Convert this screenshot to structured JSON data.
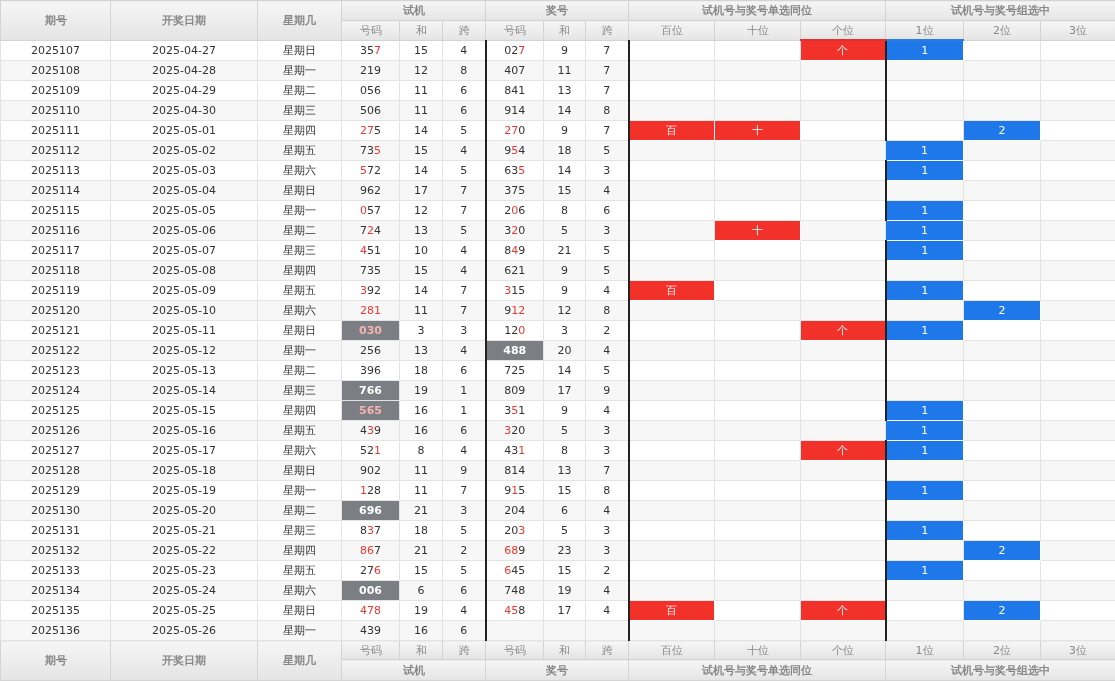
{
  "header": {
    "columns": [
      "期号",
      "开奖日期",
      "星期几"
    ],
    "groups": [
      {
        "title": "试机",
        "subs": [
          "号码",
          "和",
          "跨"
        ]
      },
      {
        "title": "奖号",
        "subs": [
          "号码",
          "和",
          "跨"
        ]
      },
      {
        "title": "试机号与奖号单选同位",
        "subs": [
          "百位",
          "十位",
          "个位"
        ]
      },
      {
        "title": "试机号与奖号组选中",
        "subs": [
          "1位",
          "2位",
          "3位"
        ]
      }
    ]
  },
  "rows": [
    {
      "issue": "2025107",
      "date": "2025-04-27",
      "weekday": "星期日",
      "test": {
        "num": "357",
        "red": [
          false,
          false,
          true
        ],
        "highlight": false,
        "sum": "15",
        "span": "4"
      },
      "draw": {
        "num": "027",
        "red": [
          false,
          false,
          true
        ],
        "highlight": false,
        "sum": "9",
        "span": "7"
      },
      "single": {
        "units": "个"
      },
      "group": {
        "first": "1"
      }
    },
    {
      "issue": "2025108",
      "date": "2025-04-28",
      "weekday": "星期一",
      "test": {
        "num": "219",
        "red": [
          false,
          false,
          false
        ],
        "highlight": false,
        "sum": "12",
        "span": "8"
      },
      "draw": {
        "num": "407",
        "red": [
          false,
          false,
          false
        ],
        "highlight": false,
        "sum": "11",
        "span": "7"
      }
    },
    {
      "issue": "2025109",
      "date": "2025-04-29",
      "weekday": "星期二",
      "test": {
        "num": "056",
        "red": [
          false,
          false,
          false
        ],
        "highlight": false,
        "sum": "11",
        "span": "6"
      },
      "draw": {
        "num": "841",
        "red": [
          false,
          false,
          false
        ],
        "highlight": false,
        "sum": "13",
        "span": "7"
      }
    },
    {
      "issue": "2025110",
      "date": "2025-04-30",
      "weekday": "星期三",
      "test": {
        "num": "506",
        "red": [
          false,
          false,
          false
        ],
        "highlight": false,
        "sum": "11",
        "span": "6"
      },
      "draw": {
        "num": "914",
        "red": [
          false,
          false,
          false
        ],
        "highlight": false,
        "sum": "14",
        "span": "8"
      }
    },
    {
      "issue": "2025111",
      "date": "2025-05-01",
      "weekday": "星期四",
      "test": {
        "num": "275",
        "red": [
          true,
          true,
          false
        ],
        "highlight": false,
        "sum": "14",
        "span": "5"
      },
      "draw": {
        "num": "270",
        "red": [
          true,
          true,
          false
        ],
        "highlight": false,
        "sum": "9",
        "span": "7"
      },
      "single": {
        "hundreds": "百",
        "tens": "十"
      },
      "group": {
        "second": "2"
      }
    },
    {
      "issue": "2025112",
      "date": "2025-05-02",
      "weekday": "星期五",
      "test": {
        "num": "735",
        "red": [
          false,
          false,
          true
        ],
        "highlight": false,
        "sum": "15",
        "span": "4"
      },
      "draw": {
        "num": "954",
        "red": [
          false,
          true,
          false
        ],
        "highlight": false,
        "sum": "18",
        "span": "5"
      },
      "group": {
        "first": "1"
      }
    },
    {
      "issue": "2025113",
      "date": "2025-05-03",
      "weekday": "星期六",
      "test": {
        "num": "572",
        "red": [
          true,
          false,
          false
        ],
        "highlight": false,
        "sum": "14",
        "span": "5"
      },
      "draw": {
        "num": "635",
        "red": [
          false,
          false,
          true
        ],
        "highlight": false,
        "sum": "14",
        "span": "3"
      },
      "group": {
        "first": "1"
      }
    },
    {
      "issue": "2025114",
      "date": "2025-05-04",
      "weekday": "星期日",
      "test": {
        "num": "962",
        "red": [
          false,
          false,
          false
        ],
        "highlight": false,
        "sum": "17",
        "span": "7"
      },
      "draw": {
        "num": "375",
        "red": [
          false,
          false,
          false
        ],
        "highlight": false,
        "sum": "15",
        "span": "4"
      }
    },
    {
      "issue": "2025115",
      "date": "2025-05-05",
      "weekday": "星期一",
      "test": {
        "num": "057",
        "red": [
          true,
          false,
          false
        ],
        "highlight": false,
        "sum": "12",
        "span": "7"
      },
      "draw": {
        "num": "206",
        "red": [
          false,
          true,
          false
        ],
        "highlight": false,
        "sum": "8",
        "span": "6"
      },
      "group": {
        "first": "1"
      }
    },
    {
      "issue": "2025116",
      "date": "2025-05-06",
      "weekday": "星期二",
      "test": {
        "num": "724",
        "red": [
          false,
          true,
          false
        ],
        "highlight": false,
        "sum": "13",
        "span": "5"
      },
      "draw": {
        "num": "320",
        "red": [
          false,
          true,
          false
        ],
        "highlight": false,
        "sum": "5",
        "span": "3"
      },
      "single": {
        "tens": "十"
      },
      "group": {
        "first": "1"
      }
    },
    {
      "issue": "2025117",
      "date": "2025-05-07",
      "weekday": "星期三",
      "test": {
        "num": "451",
        "red": [
          true,
          false,
          false
        ],
        "highlight": false,
        "sum": "10",
        "span": "4"
      },
      "draw": {
        "num": "849",
        "red": [
          false,
          true,
          false
        ],
        "highlight": false,
        "sum": "21",
        "span": "5"
      },
      "group": {
        "first": "1"
      }
    },
    {
      "issue": "2025118",
      "date": "2025-05-08",
      "weekday": "星期四",
      "test": {
        "num": "735",
        "red": [
          false,
          false,
          false
        ],
        "highlight": false,
        "sum": "15",
        "span": "4"
      },
      "draw": {
        "num": "621",
        "red": [
          false,
          false,
          false
        ],
        "highlight": false,
        "sum": "9",
        "span": "5"
      }
    },
    {
      "issue": "2025119",
      "date": "2025-05-09",
      "weekday": "星期五",
      "test": {
        "num": "392",
        "red": [
          true,
          false,
          false
        ],
        "highlight": false,
        "sum": "14",
        "span": "7"
      },
      "draw": {
        "num": "315",
        "red": [
          true,
          false,
          false
        ],
        "highlight": false,
        "sum": "9",
        "span": "4"
      },
      "single": {
        "hundreds": "百"
      },
      "group": {
        "first": "1"
      }
    },
    {
      "issue": "2025120",
      "date": "2025-05-10",
      "weekday": "星期六",
      "test": {
        "num": "281",
        "red": [
          true,
          true,
          true
        ],
        "highlight": false,
        "sum": "11",
        "span": "7"
      },
      "draw": {
        "num": "912",
        "red": [
          false,
          true,
          true
        ],
        "highlight": false,
        "sum": "12",
        "span": "8"
      },
      "group": {
        "second": "2"
      }
    },
    {
      "issue": "2025121",
      "date": "2025-05-11",
      "weekday": "星期日",
      "test": {
        "num": "030",
        "red": [
          true,
          true,
          true
        ],
        "highlight": true,
        "sum": "3",
        "span": "3"
      },
      "draw": {
        "num": "120",
        "red": [
          false,
          false,
          true
        ],
        "highlight": false,
        "sum": "3",
        "span": "2"
      },
      "single": {
        "units": "个"
      },
      "group": {
        "first": "1"
      }
    },
    {
      "issue": "2025122",
      "date": "2025-05-12",
      "weekday": "星期一",
      "test": {
        "num": "256",
        "red": [
          false,
          false,
          false
        ],
        "highlight": false,
        "sum": "13",
        "span": "4"
      },
      "draw": {
        "num": "488",
        "red": [
          false,
          false,
          false
        ],
        "highlight": true,
        "sum": "20",
        "span": "4"
      }
    },
    {
      "issue": "2025123",
      "date": "2025-05-13",
      "weekday": "星期二",
      "test": {
        "num": "396",
        "red": [
          false,
          false,
          false
        ],
        "highlight": false,
        "sum": "18",
        "span": "6"
      },
      "draw": {
        "num": "725",
        "red": [
          false,
          false,
          false
        ],
        "highlight": false,
        "sum": "14",
        "span": "5"
      }
    },
    {
      "issue": "2025124",
      "date": "2025-05-14",
      "weekday": "星期三",
      "test": {
        "num": "766",
        "red": [
          false,
          false,
          false
        ],
        "highlight": true,
        "sum": "19",
        "span": "1"
      },
      "draw": {
        "num": "809",
        "red": [
          false,
          false,
          false
        ],
        "highlight": false,
        "sum": "17",
        "span": "9"
      }
    },
    {
      "issue": "2025125",
      "date": "2025-05-15",
      "weekday": "星期四",
      "test": {
        "num": "565",
        "red": [
          true,
          true,
          true
        ],
        "highlight": true,
        "sum": "16",
        "span": "1"
      },
      "draw": {
        "num": "351",
        "red": [
          false,
          true,
          false
        ],
        "highlight": false,
        "sum": "9",
        "span": "4"
      },
      "group": {
        "first": "1"
      }
    },
    {
      "issue": "2025126",
      "date": "2025-05-16",
      "weekday": "星期五",
      "test": {
        "num": "439",
        "red": [
          false,
          true,
          false
        ],
        "highlight": false,
        "sum": "16",
        "span": "6"
      },
      "draw": {
        "num": "320",
        "red": [
          true,
          false,
          false
        ],
        "highlight": false,
        "sum": "5",
        "span": "3"
      },
      "group": {
        "first": "1"
      }
    },
    {
      "issue": "2025127",
      "date": "2025-05-17",
      "weekday": "星期六",
      "test": {
        "num": "521",
        "red": [
          false,
          false,
          true
        ],
        "highlight": false,
        "sum": "8",
        "span": "4"
      },
      "draw": {
        "num": "431",
        "red": [
          false,
          false,
          true
        ],
        "highlight": false,
        "sum": "8",
        "span": "3"
      },
      "single": {
        "units": "个"
      },
      "group": {
        "first": "1"
      }
    },
    {
      "issue": "2025128",
      "date": "2025-05-18",
      "weekday": "星期日",
      "test": {
        "num": "902",
        "red": [
          false,
          false,
          false
        ],
        "highlight": false,
        "sum": "11",
        "span": "9"
      },
      "draw": {
        "num": "814",
        "red": [
          false,
          false,
          false
        ],
        "highlight": false,
        "sum": "13",
        "span": "7"
      }
    },
    {
      "issue": "2025129",
      "date": "2025-05-19",
      "weekday": "星期一",
      "test": {
        "num": "128",
        "red": [
          true,
          false,
          false
        ],
        "highlight": false,
        "sum": "11",
        "span": "7"
      },
      "draw": {
        "num": "915",
        "red": [
          false,
          true,
          false
        ],
        "highlight": false,
        "sum": "15",
        "span": "8"
      },
      "group": {
        "first": "1"
      }
    },
    {
      "issue": "2025130",
      "date": "2025-05-20",
      "weekday": "星期二",
      "test": {
        "num": "696",
        "red": [
          false,
          false,
          false
        ],
        "highlight": true,
        "sum": "21",
        "span": "3"
      },
      "draw": {
        "num": "204",
        "red": [
          false,
          false,
          false
        ],
        "highlight": false,
        "sum": "6",
        "span": "4"
      }
    },
    {
      "issue": "2025131",
      "date": "2025-05-21",
      "weekday": "星期三",
      "test": {
        "num": "837",
        "red": [
          false,
          true,
          false
        ],
        "highlight": false,
        "sum": "18",
        "span": "5"
      },
      "draw": {
        "num": "203",
        "red": [
          false,
          false,
          true
        ],
        "highlight": false,
        "sum": "5",
        "span": "3"
      },
      "group": {
        "first": "1"
      }
    },
    {
      "issue": "2025132",
      "date": "2025-05-22",
      "weekday": "星期四",
      "test": {
        "num": "867",
        "red": [
          true,
          true,
          false
        ],
        "highlight": false,
        "sum": "21",
        "span": "2"
      },
      "draw": {
        "num": "689",
        "red": [
          true,
          true,
          false
        ],
        "highlight": false,
        "sum": "23",
        "span": "3"
      },
      "group": {
        "second": "2"
      }
    },
    {
      "issue": "2025133",
      "date": "2025-05-23",
      "weekday": "星期五",
      "test": {
        "num": "276",
        "red": [
          false,
          false,
          true
        ],
        "highlight": false,
        "sum": "15",
        "span": "5"
      },
      "draw": {
        "num": "645",
        "red": [
          true,
          false,
          false
        ],
        "highlight": false,
        "sum": "15",
        "span": "2"
      },
      "group": {
        "first": "1"
      }
    },
    {
      "issue": "2025134",
      "date": "2025-05-24",
      "weekday": "星期六",
      "test": {
        "num": "006",
        "red": [
          false,
          false,
          false
        ],
        "highlight": true,
        "sum": "6",
        "span": "6"
      },
      "draw": {
        "num": "748",
        "red": [
          false,
          false,
          false
        ],
        "highlight": false,
        "sum": "19",
        "span": "4"
      }
    },
    {
      "issue": "2025135",
      "date": "2025-05-25",
      "weekday": "星期日",
      "test": {
        "num": "478",
        "red": [
          true,
          true,
          true
        ],
        "highlight": false,
        "sum": "19",
        "span": "4"
      },
      "draw": {
        "num": "458",
        "red": [
          true,
          true,
          false
        ],
        "highlight": false,
        "sum": "17",
        "span": "4"
      },
      "single": {
        "hundreds": "百",
        "units": "个"
      },
      "group": {
        "second": "2"
      }
    },
    {
      "issue": "2025136",
      "date": "2025-05-26",
      "weekday": "星期一",
      "test": {
        "num": "439",
        "red": [
          false,
          false,
          false
        ],
        "highlight": false,
        "sum": "16",
        "span": "6"
      }
    }
  ],
  "footer": {
    "columns": [
      "期号",
      "开奖日期",
      "星期几"
    ],
    "groups": [
      {
        "title": "试机",
        "subs": [
          "号码",
          "和",
          "跨"
        ]
      },
      {
        "title": "奖号",
        "subs": [
          "号码",
          "和",
          "跨"
        ]
      },
      {
        "title": "试机号与奖号单选同位",
        "subs": [
          "百位",
          "十位",
          "个位"
        ]
      },
      {
        "title": "试机号与奖号组选中",
        "subs": [
          "1位",
          "2位",
          "3位"
        ]
      }
    ]
  }
}
